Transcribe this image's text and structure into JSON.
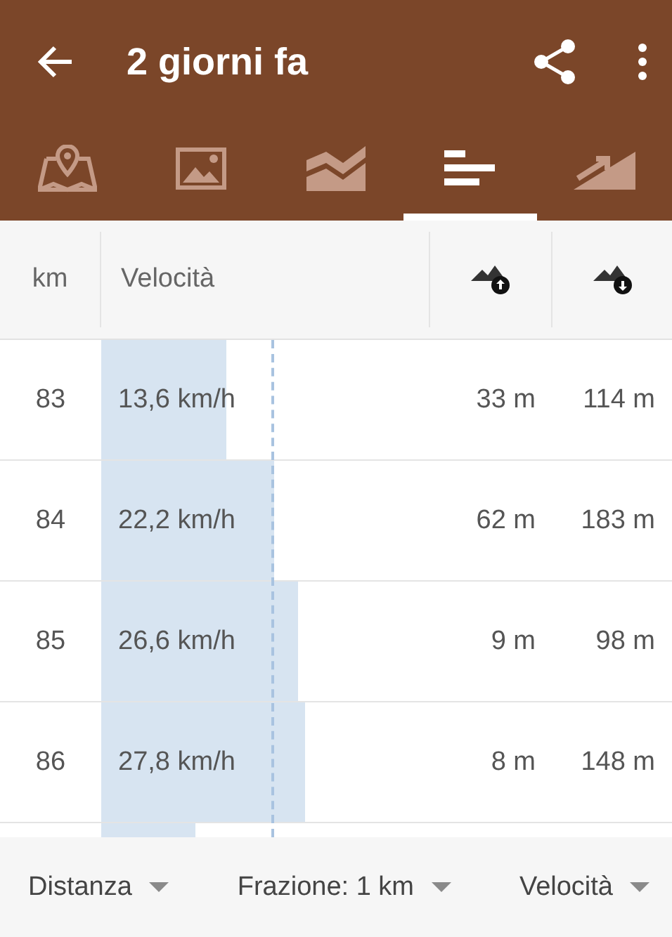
{
  "app_bar": {
    "title": "2 giorni fa"
  },
  "tabs": [
    {
      "kind": "map",
      "selected": false
    },
    {
      "kind": "photos",
      "selected": false
    },
    {
      "kind": "chart",
      "selected": false
    },
    {
      "kind": "splits",
      "selected": true
    },
    {
      "kind": "climb",
      "selected": false
    }
  ],
  "table": {
    "columns": [
      {
        "kind": "text",
        "label": "km"
      },
      {
        "kind": "text",
        "label": "Velocità"
      },
      {
        "kind": "ascent"
      },
      {
        "kind": "descent"
      }
    ],
    "rows": [
      {
        "km": "83",
        "speed": "13,6 km/h",
        "ascent": "33 m",
        "descent": "114 m"
      },
      {
        "km": "84",
        "speed": "22,2 km/h",
        "ascent": "62 m",
        "descent": "183 m"
      },
      {
        "km": "85",
        "speed": "26,6 km/h",
        "ascent": "9 m",
        "descent": "98 m"
      },
      {
        "km": "86",
        "speed": "27,8 km/h",
        "ascent": "8 m",
        "descent": "148 m"
      }
    ]
  },
  "footer": {
    "dropdowns": [
      "Distanza",
      "Frazione: 1 km",
      "Velocità"
    ]
  }
}
